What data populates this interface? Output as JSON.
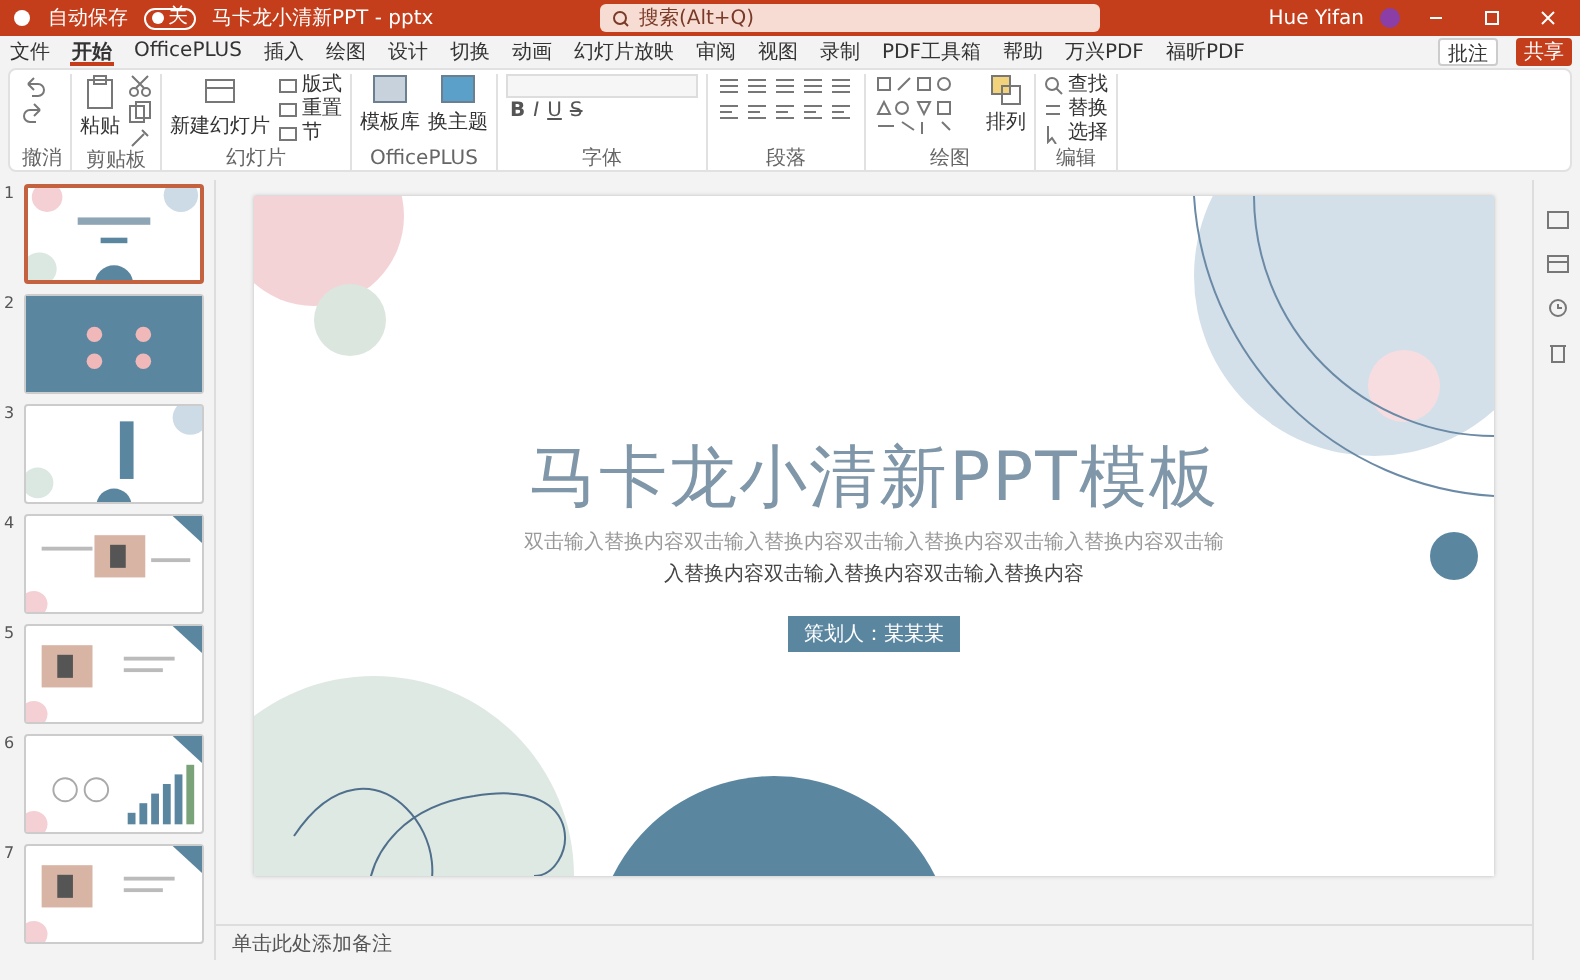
{
  "title_bar": {
    "autosave_label": "自动保存",
    "autosave_on": false,
    "autosave_state": "关",
    "document_title": "马卡龙小清新PPT - pptx",
    "search_placeholder": "搜索(Alt+Q)",
    "user_name": "Hue Yifan"
  },
  "tabs": [
    {
      "label": "文件",
      "selected": false
    },
    {
      "label": "开始",
      "selected": true
    },
    {
      "label": "OfficePLUS",
      "selected": false
    },
    {
      "label": "插入",
      "selected": false
    },
    {
      "label": "绘图",
      "selected": false
    },
    {
      "label": "设计",
      "selected": false
    },
    {
      "label": "切换",
      "selected": false
    },
    {
      "label": "动画",
      "selected": false
    },
    {
      "label": "幻灯片放映",
      "selected": false
    },
    {
      "label": "审阅",
      "selected": false
    },
    {
      "label": "视图",
      "selected": false
    },
    {
      "label": "录制",
      "selected": false
    },
    {
      "label": "PDF工具箱",
      "selected": false
    },
    {
      "label": "帮助",
      "selected": false
    },
    {
      "label": "万兴PDF",
      "selected": false
    },
    {
      "label": "福昕PDF",
      "selected": false
    }
  ],
  "comments_button": "批注",
  "share_button": "共享",
  "ribbon_groups": [
    {
      "label": "撤消",
      "kind": "undo"
    },
    {
      "label": "剪贴板",
      "kind": "clipboard",
      "big": "粘贴"
    },
    {
      "label": "幻灯片",
      "kind": "slides",
      "big": "新建幻灯片",
      "small": [
        "版式",
        "重置",
        "节"
      ]
    },
    {
      "label": "OfficePLUS",
      "kind": "officeplus",
      "buttons": [
        "模板库",
        "换主题"
      ]
    },
    {
      "label": "字体",
      "kind": "font",
      "format": [
        "B",
        "I",
        "U",
        "S"
      ]
    },
    {
      "label": "段落",
      "kind": "paragraph"
    },
    {
      "label": "绘图",
      "kind": "drawing",
      "big": "排列"
    },
    {
      "label": "编辑",
      "kind": "editing",
      "small": [
        "查找",
        "替换",
        "选择"
      ]
    }
  ],
  "thumbnails": [
    {
      "number": "1",
      "kind": "title",
      "selected": true
    },
    {
      "number": "2",
      "kind": "agenda",
      "selected": false
    },
    {
      "number": "3",
      "kind": "section",
      "selected": false
    },
    {
      "number": "4",
      "selected": false
    },
    {
      "number": "5",
      "selected": false
    },
    {
      "number": "6",
      "kind": "chart",
      "selected": false
    },
    {
      "number": "7",
      "selected": false
    }
  ],
  "slide": {
    "title": "马卡龙小清新PPT模板",
    "lines": [
      "双击输入替换内容双击输入替换内容双击输入替换内容双击输入替换内容双击输",
      "入替换内容双击输入替换内容双击输入替换内容"
    ],
    "presenter": "策划人：某某某"
  },
  "notes_placeholder": "单击此处添加备注"
}
